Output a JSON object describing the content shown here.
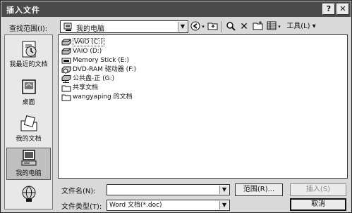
{
  "window": {
    "title": "插入文件"
  },
  "titlebar": {
    "help_glyph": "?",
    "close_glyph": "✕"
  },
  "lookin": {
    "label": "查找范围(I):",
    "value": "我的电脑"
  },
  "toolbar": {
    "tools_label": "工具(L)"
  },
  "places": [
    {
      "label": "我最近的文档",
      "icon": "recent-documents-icon"
    },
    {
      "label": "桌面",
      "icon": "desktop-icon"
    },
    {
      "label": "我的文档",
      "icon": "my-documents-icon"
    },
    {
      "label": "我的电脑",
      "icon": "my-computer-icon"
    },
    {
      "label": "",
      "icon": "network-places-icon"
    }
  ],
  "files": [
    {
      "name": "VAIO (C:)",
      "icon": "hard-drive-icon"
    },
    {
      "name": "VAIO (D:)",
      "icon": "hard-drive-icon"
    },
    {
      "name": "Memory Stick (E:)",
      "icon": "memory-stick-icon"
    },
    {
      "name": "DVD-RAM 驱动器 (F:)",
      "icon": "dvd-drive-icon"
    },
    {
      "name": "公共盘-正 (G:)",
      "icon": "network-drive-icon"
    },
    {
      "name": "共享文档",
      "icon": "folder-icon"
    },
    {
      "name": "wangyaping 的文档",
      "icon": "folder-icon"
    }
  ],
  "filename": {
    "label": "文件名(N):",
    "value": ""
  },
  "filetype": {
    "label": "文件类型(T):",
    "value": "Word 文档(*.doc)"
  },
  "buttons": {
    "range": "范围(R)...",
    "insert": "插入(S)",
    "cancel": "取消"
  }
}
